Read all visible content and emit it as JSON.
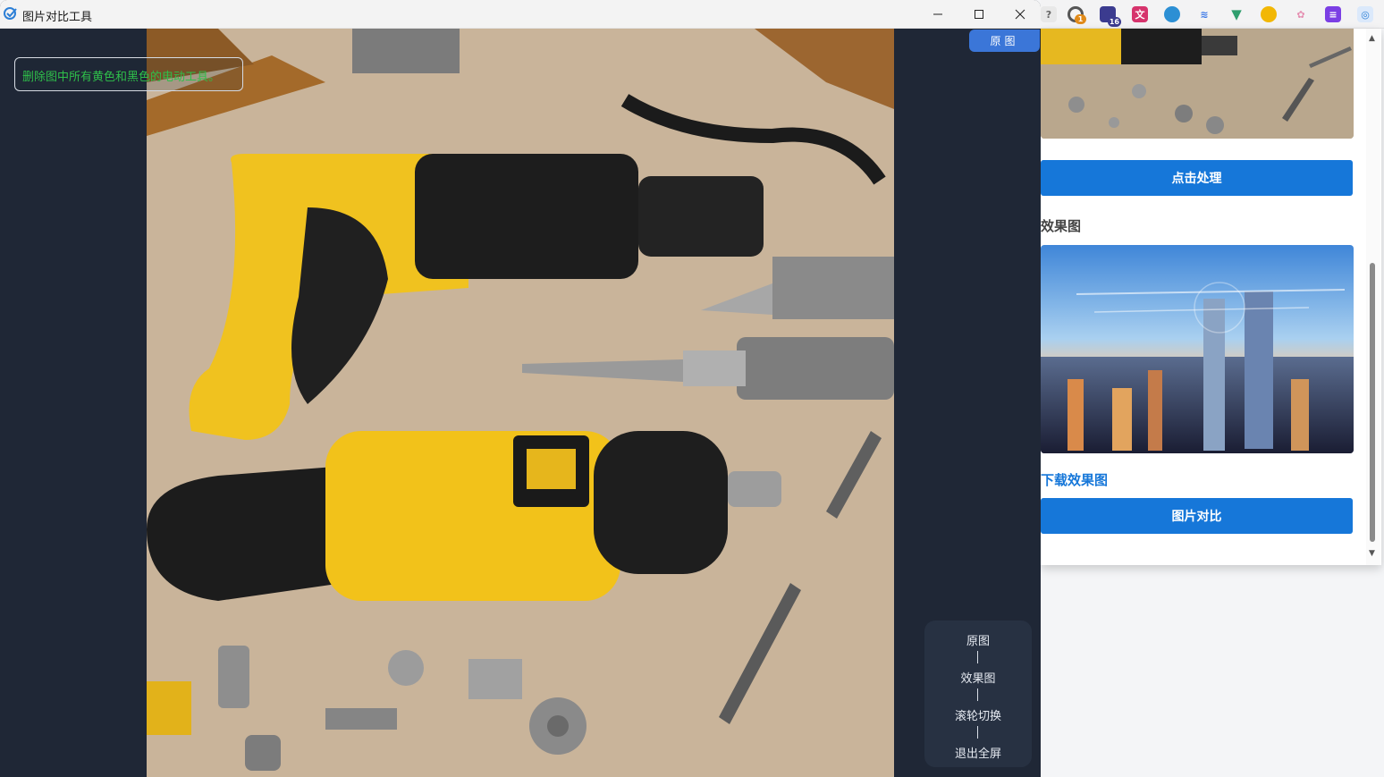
{
  "window": {
    "title": "图片对比工具",
    "minimize_icon": "minimize-icon",
    "maximize_icon": "maximize-icon",
    "close_icon": "close-icon"
  },
  "viewer": {
    "prompt_text": "删除图中所有黄色和黑色的电动工具。",
    "current_view_badge": "原图",
    "controls": {
      "original": "原图",
      "effect": "效果图",
      "scroll_switch": "滚轮切换",
      "exit_fullscreen": "退出全屏",
      "separator": "|"
    }
  },
  "popup": {
    "process_button": "点击处理",
    "effect_label": "效果图",
    "download_link": "下载效果图",
    "compare_button": "图片对比"
  },
  "extensions": {
    "badge_1": "1",
    "badge_2": "16"
  },
  "colors": {
    "accent_blue": "#1677d9",
    "prompt_green": "#2fbf4a",
    "stage_bg": "#1f2736"
  }
}
